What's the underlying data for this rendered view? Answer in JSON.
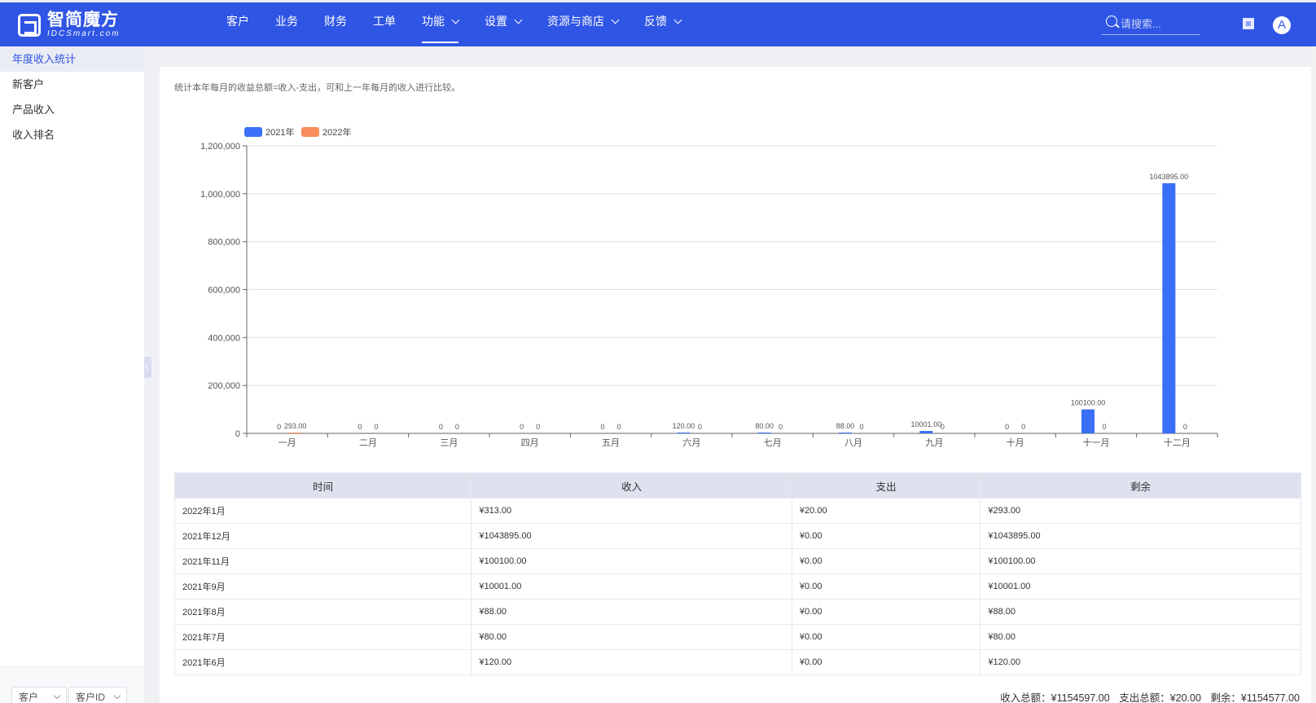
{
  "logo": {
    "title": "智简魔方",
    "subtitle": "IDCSmart.com"
  },
  "nav": {
    "items": [
      {
        "label": "客户",
        "dropdown": false,
        "active": false
      },
      {
        "label": "业务",
        "dropdown": false,
        "active": false
      },
      {
        "label": "财务",
        "dropdown": false,
        "active": false
      },
      {
        "label": "工单",
        "dropdown": false,
        "active": false
      },
      {
        "label": "功能",
        "dropdown": true,
        "active": true
      },
      {
        "label": "设置",
        "dropdown": true,
        "active": false
      },
      {
        "label": "资源与商店",
        "dropdown": true,
        "active": false
      },
      {
        "label": "反馈",
        "dropdown": true,
        "active": false
      }
    ],
    "search_placeholder": "请搜索...",
    "avatar_letter": "A"
  },
  "sidebar": {
    "items": [
      "年度收入统计",
      "新客户",
      "产品收入",
      "收入排名"
    ],
    "active_index": 0,
    "bottom_select_1": "客户",
    "bottom_select_2": "客户ID"
  },
  "main": {
    "description": "统计本年每月的收益总额=收入-支出，可和上一年每月的收入进行比较。"
  },
  "chart_data": {
    "type": "bar",
    "categories": [
      "一月",
      "二月",
      "三月",
      "四月",
      "五月",
      "六月",
      "七月",
      "八月",
      "九月",
      "十月",
      "十一月",
      "十二月"
    ],
    "series": [
      {
        "name": "2021年",
        "color": "#3a6ff7",
        "values": [
          0,
          0,
          0,
          0,
          0,
          120,
          80,
          88,
          10001,
          0,
          100100,
          1043895
        ],
        "labels": [
          "0",
          "0",
          "0",
          "0",
          "0",
          "120.00",
          "80.00",
          "88.00",
          "10001.00",
          "0",
          "100100.00",
          "1043895.00"
        ]
      },
      {
        "name": "2022年",
        "color": "#f88e5b",
        "values": [
          293,
          0,
          0,
          0,
          0,
          0,
          0,
          0,
          0,
          0,
          0,
          0
        ],
        "labels": [
          "293.00",
          "0",
          "0",
          "0",
          "0",
          "0",
          "0",
          "0",
          "0",
          "0",
          "0",
          "0"
        ]
      }
    ],
    "ylim": [
      0,
      1200000
    ],
    "yticks": [
      "0",
      "200,000",
      "400,000",
      "600,000",
      "800,000",
      "1,000,000",
      "1,200,000"
    ],
    "legend": "top-left",
    "grid": true
  },
  "table": {
    "headers": [
      "时间",
      "收入",
      "支出",
      "剩余"
    ],
    "rows": [
      [
        "2022年1月",
        "¥313.00",
        "¥20.00",
        "¥293.00"
      ],
      [
        "2021年12月",
        "¥1043895.00",
        "¥0.00",
        "¥1043895.00"
      ],
      [
        "2021年11月",
        "¥100100.00",
        "¥0.00",
        "¥100100.00"
      ],
      [
        "2021年9月",
        "¥10001.00",
        "¥0.00",
        "¥10001.00"
      ],
      [
        "2021年8月",
        "¥88.00",
        "¥0.00",
        "¥88.00"
      ],
      [
        "2021年7月",
        "¥80.00",
        "¥0.00",
        "¥80.00"
      ],
      [
        "2021年6月",
        "¥120.00",
        "¥0.00",
        "¥120.00"
      ]
    ]
  },
  "totals": {
    "income": "收入总额：¥1154597.00",
    "expense": "支出总额：¥20.00",
    "remain": "剩余：¥1154577.00"
  }
}
